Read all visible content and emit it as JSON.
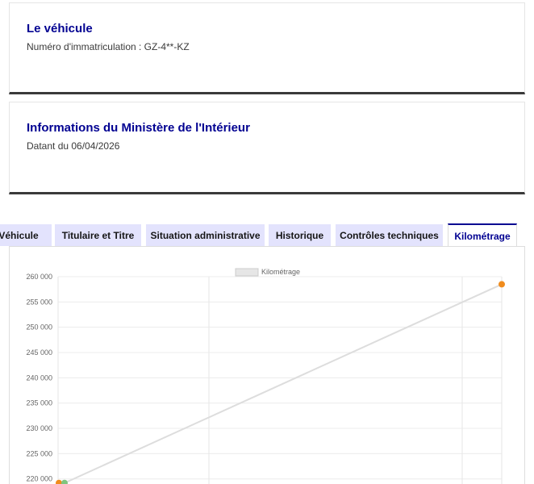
{
  "vehicle_card": {
    "title": "Le véhicule",
    "registration": "Numéro d'immatriculation : GZ-4**-KZ"
  },
  "ministry_card": {
    "title": "Informations du Ministère de l'Intérieur",
    "date": "Datant du 06/04/2026"
  },
  "tabs": [
    {
      "label": "Véhicule",
      "active": false
    },
    {
      "label": "Titulaire et Titre",
      "active": false
    },
    {
      "label": "Situation administrative",
      "active": false
    },
    {
      "label": "Historique",
      "active": false
    },
    {
      "label": "Contrôles techniques",
      "active": false
    },
    {
      "label": "Kilométrage",
      "active": true
    }
  ],
  "chart_data": {
    "type": "line",
    "legend": [
      "Kilométrage"
    ],
    "legend_position": "top-center",
    "grid": true,
    "y_ticks": [
      "220 000",
      "225 000",
      "230 000",
      "235 000",
      "240 000",
      "245 000",
      "250 000",
      "255 000",
      "260 000"
    ],
    "ylim": [
      219000,
      260000
    ],
    "series": [
      {
        "name": "Kilométrage",
        "line_color": "#dddddd",
        "points": [
          {
            "y": 219200,
            "color": "#f08c1e"
          },
          {
            "y": 219200,
            "color": "#7fc57f"
          },
          {
            "y": 258500,
            "color": "#f08c1e"
          }
        ]
      }
    ]
  }
}
